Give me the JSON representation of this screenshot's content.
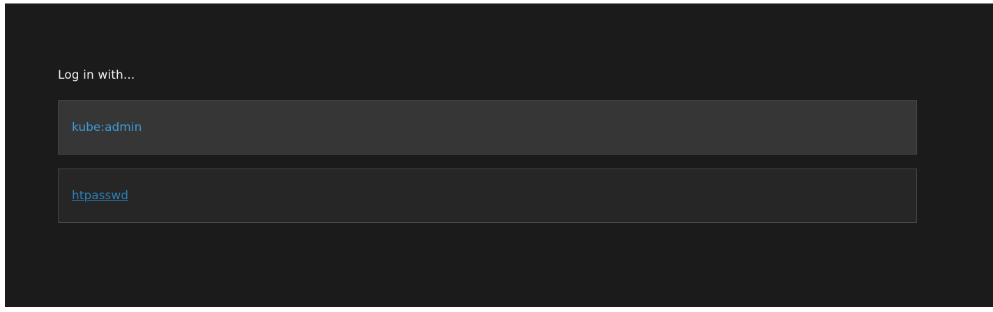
{
  "login": {
    "heading": "Log in with...",
    "providers": [
      {
        "label": "kube:admin",
        "state": "hover"
      },
      {
        "label": "htpasswd",
        "state": "default"
      }
    ]
  },
  "colors": {
    "background": "#1b1b1b",
    "link": "#3d9bd6",
    "link_visited": "#2b7fb6",
    "border": "#474747"
  }
}
